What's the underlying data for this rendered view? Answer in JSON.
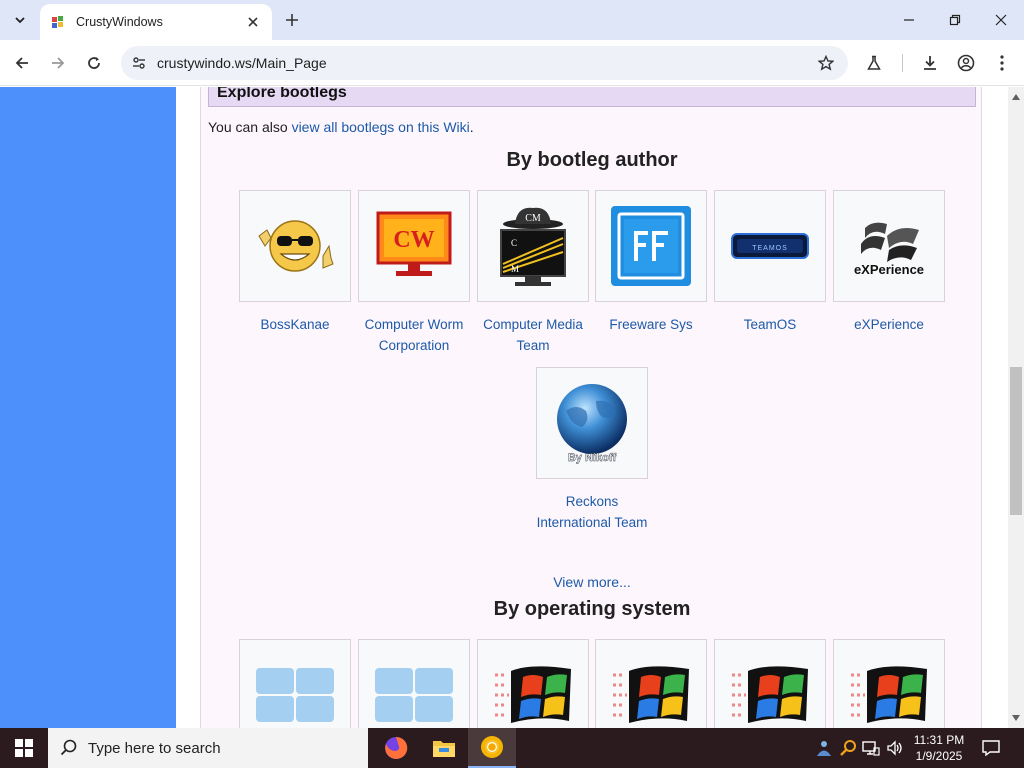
{
  "browser": {
    "tab_title": "CrustyWindows",
    "url": "crustywindo.ws/Main_Page"
  },
  "page": {
    "section_heading": "Explore bootlegs",
    "intro_prefix": "You can also ",
    "intro_link": "view all bootlegs on this Wiki",
    "intro_suffix": ".",
    "by_author_heading": "By bootleg author",
    "authors": [
      {
        "label": "BossKanae",
        "icon": "sunglasses-smiley-icon"
      },
      {
        "label": "Computer Worm Corporation",
        "icon": "cw-monitor-icon"
      },
      {
        "label": "Computer Media Team",
        "icon": "cm-monitor-hat-icon"
      },
      {
        "label": "Freeware Sys",
        "icon": "freeware-sys-logo-icon"
      },
      {
        "label": "TeamOS",
        "icon": "teamos-logo-icon"
      },
      {
        "label": "eXPerience",
        "icon": "experience-logo-icon"
      },
      {
        "label": "Reckons International Team",
        "icon": "globe-icon"
      }
    ],
    "view_more": "View more...",
    "by_os_heading": "By operating system",
    "os_items": [
      {
        "icon": "windows-11-logo-icon"
      },
      {
        "icon": "windows-11-logo-icon"
      },
      {
        "icon": "windows-xp-flag-icon"
      },
      {
        "icon": "windows-xp-flag-icon"
      },
      {
        "icon": "windows-xp-flag-icon"
      },
      {
        "icon": "windows-xp-flag-icon"
      }
    ]
  },
  "taskbar": {
    "search_placeholder": "Type here to search",
    "time": "11:31 PM",
    "date": "1/9/2025"
  },
  "colors": {
    "sidebar": "#4d8ffb",
    "link": "#1d5aa8",
    "panel": "#fdf6fc",
    "section_head": "#e6d9f3"
  }
}
